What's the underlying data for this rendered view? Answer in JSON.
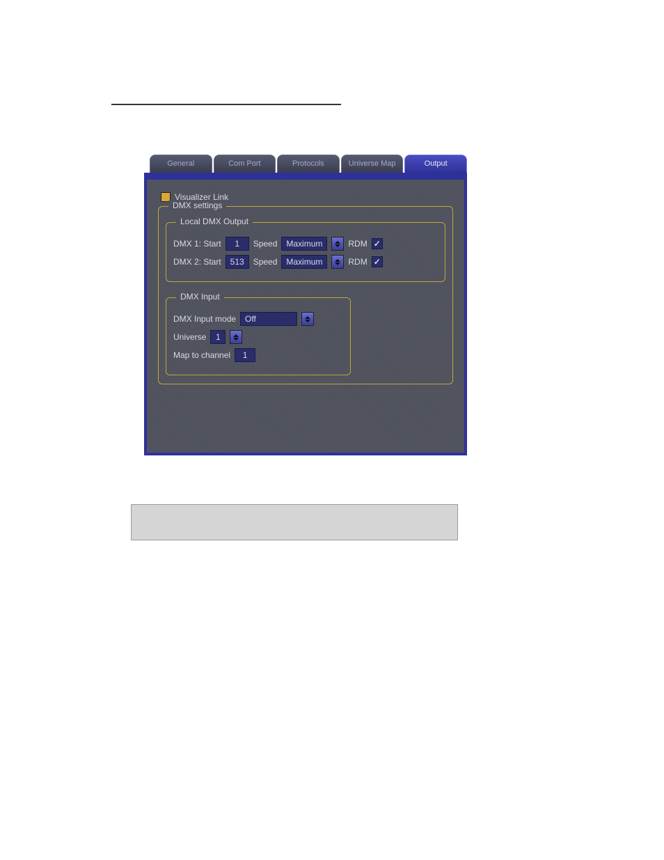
{
  "tabs": {
    "general": "General",
    "comport": "Com Port",
    "protocols": "Protocols",
    "universemap": "Universe Map",
    "output": "Output"
  },
  "visualizer": {
    "label": "Visualizer Link"
  },
  "dmx_settings": {
    "legend": "DMX settings",
    "local_output": {
      "legend": "Local DMX Output",
      "row1": {
        "label": "DMX 1: Start",
        "start": "1",
        "speed_label": "Speed",
        "speed_value": "Maximum",
        "rdm_label": "RDM",
        "rdm_checked": "✓"
      },
      "row2": {
        "label": "DMX 2: Start",
        "start": "513",
        "speed_label": "Speed",
        "speed_value": "Maximum",
        "rdm_label": "RDM",
        "rdm_checked": "✓"
      }
    },
    "dmx_input": {
      "legend": "DMX Input",
      "mode_label": "DMX Input mode",
      "mode_value": "Off",
      "universe_label": "Universe",
      "universe_value": "1",
      "map_label": "Map to channel",
      "map_value": "1"
    }
  }
}
